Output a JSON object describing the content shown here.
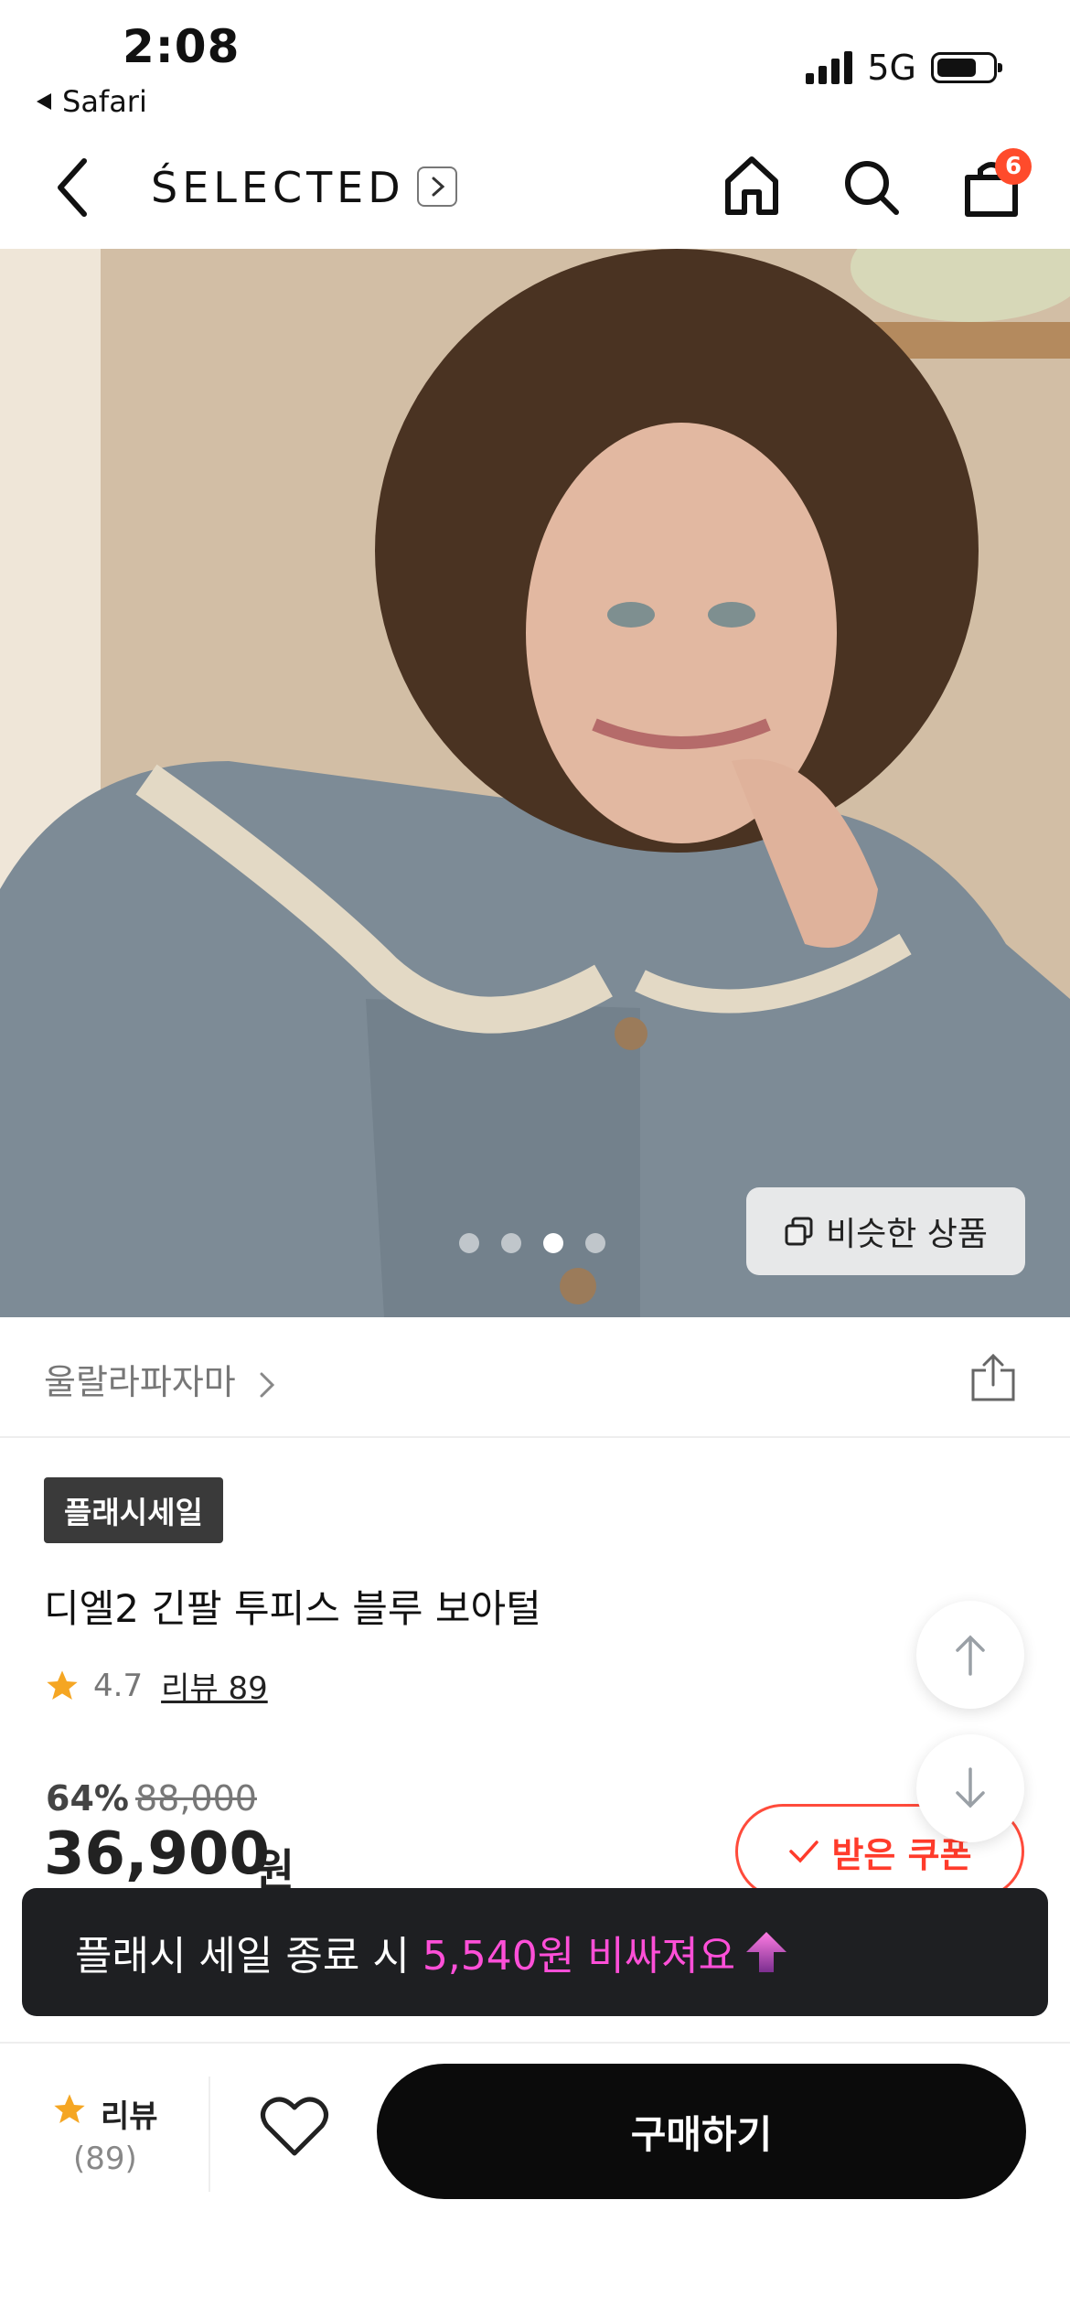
{
  "status_bar": {
    "time": "2:08",
    "back_app": "Safari",
    "network": "5G"
  },
  "header": {
    "brand": "ŚELECTED",
    "cart_count": "6"
  },
  "gallery": {
    "total_images": 4,
    "active_index": 2,
    "similar_button": "비슷한 상품"
  },
  "brand_row": {
    "brand_name": "울랄라파자마"
  },
  "product": {
    "flash_tag": "플래시세일",
    "title": "디엘2 긴팔 투피스 블루 보아털",
    "rating": "4.7",
    "review_label": "리뷰 89",
    "discount": "64%",
    "original_price": "88,000",
    "price": "36,900",
    "currency": "원",
    "coupon_button": "받은 쿠폰"
  },
  "toast": {
    "text_prefix": "플래시 세일 종료 시",
    "highlight": "5,540원 비싸져요"
  },
  "bottom_bar": {
    "review_label": "리뷰",
    "review_count": "(89)",
    "buy_button": "구매하기"
  },
  "colors": {
    "accent_red": "#ff4b3b",
    "toast_highlight": "#ff4fd8",
    "star": "#f5a623"
  }
}
